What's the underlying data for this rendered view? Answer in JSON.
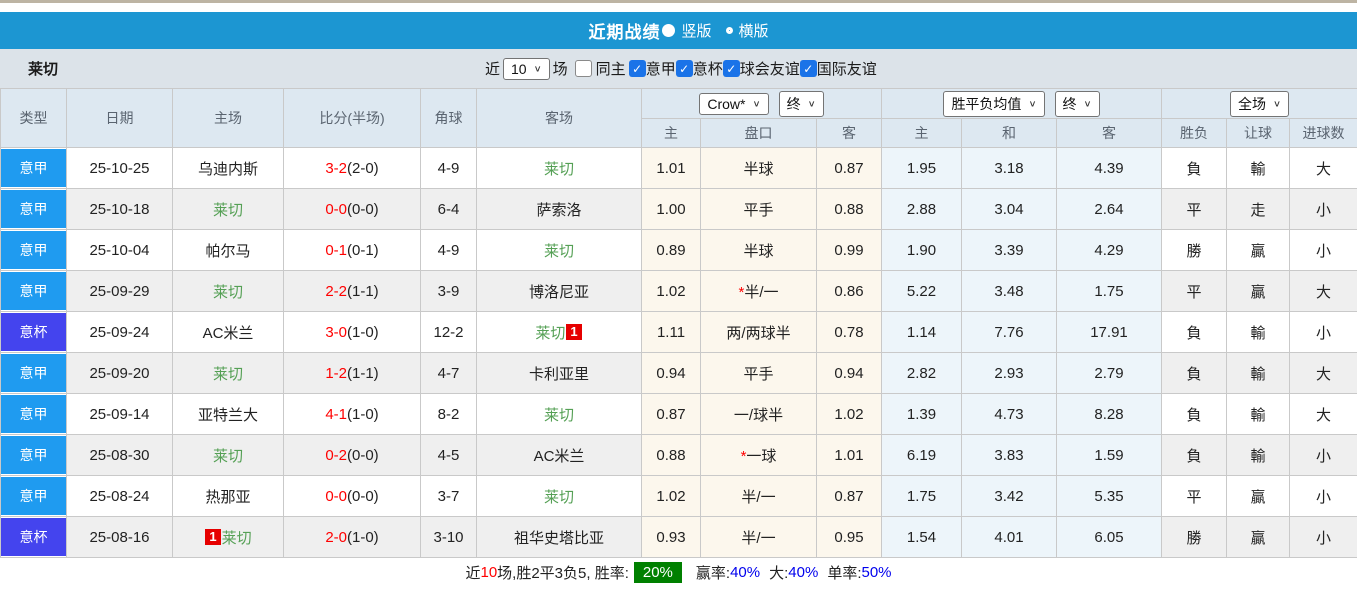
{
  "title_bar": {
    "title": "近期战绩",
    "radio_vertical": "竖版",
    "radio_horizontal": "横版"
  },
  "filter_bar": {
    "team": "莱切",
    "near_label": "近",
    "matches_select": "10",
    "matches_label": "场",
    "same_home_label": "同主",
    "same_home_checked": false,
    "checkboxes": [
      {
        "label": "意甲",
        "checked": true
      },
      {
        "label": "意杯",
        "checked": true
      },
      {
        "label": "球会友谊",
        "checked": true
      },
      {
        "label": "国际友谊",
        "checked": true
      }
    ]
  },
  "table": {
    "static_headers": [
      "类型",
      "日期",
      "主场",
      "比分(半场)",
      "角球",
      "客场"
    ],
    "odds_group": {
      "select1": "Crow*",
      "select2": "终",
      "columns": [
        "主",
        "盘口",
        "客"
      ]
    },
    "avg_group": {
      "select1": "胜平负均值",
      "select2": "终",
      "columns": [
        "主",
        "和",
        "客"
      ]
    },
    "result_group": {
      "select": "全场",
      "columns": [
        "胜负",
        "让球",
        "进球数"
      ]
    },
    "rows": [
      {
        "league": "意甲",
        "league_type": "serie_a",
        "date": "25-10-25",
        "home": {
          "name": "乌迪内斯",
          "lecce": false,
          "badge": null
        },
        "score": {
          "full": "3-2",
          "half": "(2-0)"
        },
        "corners": "4-9",
        "away": {
          "name": "莱切",
          "lecce": true,
          "badge": null
        },
        "odds": {
          "home": "1.01",
          "star": false,
          "handicap": "半球",
          "away": "0.87"
        },
        "avg": {
          "home": "1.95",
          "draw": "3.18",
          "away": "4.39"
        },
        "results": {
          "wdl": "負",
          "wdl_color": "green",
          "handicap": "輸",
          "handicap_color": "green",
          "goals": "大",
          "goals_color": "big"
        }
      },
      {
        "league": "意甲",
        "league_type": "serie_a",
        "date": "25-10-18",
        "home": {
          "name": "莱切",
          "lecce": true,
          "badge": null
        },
        "score": {
          "full": "0-0",
          "half": "(0-0)"
        },
        "corners": "6-4",
        "away": {
          "name": "萨索洛",
          "lecce": false,
          "badge": null
        },
        "odds": {
          "home": "1.00",
          "star": false,
          "handicap": "平手",
          "away": "0.88"
        },
        "avg": {
          "home": "2.88",
          "draw": "3.04",
          "away": "2.64"
        },
        "results": {
          "wdl": "平",
          "wdl_color": "blue",
          "handicap": "走",
          "handicap_color": "blue",
          "goals": "小",
          "goals_color": "small"
        }
      },
      {
        "league": "意甲",
        "league_type": "serie_a",
        "date": "25-10-04",
        "home": {
          "name": "帕尔马",
          "lecce": false,
          "badge": null
        },
        "score": {
          "full": "0-1",
          "half": "(0-1)"
        },
        "corners": "4-9",
        "away": {
          "name": "莱切",
          "lecce": true,
          "badge": null
        },
        "odds": {
          "home": "0.89",
          "star": false,
          "handicap": "半球",
          "away": "0.99"
        },
        "avg": {
          "home": "1.90",
          "draw": "3.39",
          "away": "4.29"
        },
        "results": {
          "wdl": "勝",
          "wdl_color": "red",
          "handicap": "贏",
          "handicap_color": "red",
          "goals": "小",
          "goals_color": "small"
        }
      },
      {
        "league": "意甲",
        "league_type": "serie_a",
        "date": "25-09-29",
        "home": {
          "name": "莱切",
          "lecce": true,
          "badge": null
        },
        "score": {
          "full": "2-2",
          "half": "(1-1)"
        },
        "corners": "3-9",
        "away": {
          "name": "博洛尼亚",
          "lecce": false,
          "badge": null
        },
        "odds": {
          "home": "1.02",
          "star": true,
          "handicap": "半/一",
          "away": "0.86"
        },
        "avg": {
          "home": "5.22",
          "draw": "3.48",
          "away": "1.75"
        },
        "results": {
          "wdl": "平",
          "wdl_color": "blue",
          "handicap": "贏",
          "handicap_color": "red",
          "goals": "大",
          "goals_color": "big"
        }
      },
      {
        "league": "意杯",
        "league_type": "italy_cup",
        "date": "25-09-24",
        "home": {
          "name": "AC米兰",
          "lecce": false,
          "badge": null
        },
        "score": {
          "full": "3-0",
          "half": "(1-0)"
        },
        "corners": "12-2",
        "away": {
          "name": "莱切",
          "lecce": true,
          "badge": {
            "text": "1",
            "pos": "after"
          }
        },
        "odds": {
          "home": "1.11",
          "star": false,
          "handicap": "两/两球半",
          "away": "0.78"
        },
        "avg": {
          "home": "1.14",
          "draw": "7.76",
          "away": "17.91"
        },
        "results": {
          "wdl": "負",
          "wdl_color": "green",
          "handicap": "輸",
          "handicap_color": "green",
          "goals": "小",
          "goals_color": "small"
        }
      },
      {
        "league": "意甲",
        "league_type": "serie_a",
        "date": "25-09-20",
        "home": {
          "name": "莱切",
          "lecce": true,
          "badge": null
        },
        "score": {
          "full": "1-2",
          "half": "(1-1)"
        },
        "corners": "4-7",
        "away": {
          "name": "卡利亚里",
          "lecce": false,
          "badge": null
        },
        "odds": {
          "home": "0.94",
          "star": false,
          "handicap": "平手",
          "away": "0.94"
        },
        "avg": {
          "home": "2.82",
          "draw": "2.93",
          "away": "2.79"
        },
        "results": {
          "wdl": "負",
          "wdl_color": "green",
          "handicap": "輸",
          "handicap_color": "green",
          "goals": "大",
          "goals_color": "big"
        }
      },
      {
        "league": "意甲",
        "league_type": "serie_a",
        "date": "25-09-14",
        "home": {
          "name": "亚特兰大",
          "lecce": false,
          "badge": null
        },
        "score": {
          "full": "4-1",
          "half": "(1-0)"
        },
        "corners": "8-2",
        "away": {
          "name": "莱切",
          "lecce": true,
          "badge": null
        },
        "odds": {
          "home": "0.87",
          "star": false,
          "handicap": "一/球半",
          "away": "1.02"
        },
        "avg": {
          "home": "1.39",
          "draw": "4.73",
          "away": "8.28"
        },
        "results": {
          "wdl": "負",
          "wdl_color": "green",
          "handicap": "輸",
          "handicap_color": "green",
          "goals": "大",
          "goals_color": "big"
        }
      },
      {
        "league": "意甲",
        "league_type": "serie_a",
        "date": "25-08-30",
        "home": {
          "name": "莱切",
          "lecce": true,
          "badge": null
        },
        "score": {
          "full": "0-2",
          "half": "(0-0)"
        },
        "corners": "4-5",
        "away": {
          "name": "AC米兰",
          "lecce": false,
          "badge": null
        },
        "odds": {
          "home": "0.88",
          "star": true,
          "handicap": "一球",
          "away": "1.01"
        },
        "avg": {
          "home": "6.19",
          "draw": "3.83",
          "away": "1.59"
        },
        "results": {
          "wdl": "負",
          "wdl_color": "green",
          "handicap": "輸",
          "handicap_color": "green",
          "goals": "小",
          "goals_color": "small"
        }
      },
      {
        "league": "意甲",
        "league_type": "serie_a",
        "date": "25-08-24",
        "home": {
          "name": "热那亚",
          "lecce": false,
          "badge": null
        },
        "score": {
          "full": "0-0",
          "half": "(0-0)"
        },
        "corners": "3-7",
        "away": {
          "name": "莱切",
          "lecce": true,
          "badge": null
        },
        "odds": {
          "home": "1.02",
          "star": false,
          "handicap": "半/一",
          "away": "0.87"
        },
        "avg": {
          "home": "1.75",
          "draw": "3.42",
          "away": "5.35"
        },
        "results": {
          "wdl": "平",
          "wdl_color": "blue",
          "handicap": "贏",
          "handicap_color": "red",
          "goals": "小",
          "goals_color": "small"
        }
      },
      {
        "league": "意杯",
        "league_type": "italy_cup",
        "date": "25-08-16",
        "home": {
          "name": "莱切",
          "lecce": true,
          "badge": {
            "text": "1",
            "pos": "before"
          }
        },
        "score": {
          "full": "2-0",
          "half": "(1-0)"
        },
        "corners": "3-10",
        "away": {
          "name": "祖华史塔比亚",
          "lecce": false,
          "badge": null
        },
        "odds": {
          "home": "0.93",
          "star": false,
          "handicap": "半/一",
          "away": "0.95"
        },
        "avg": {
          "home": "1.54",
          "draw": "4.01",
          "away": "6.05"
        },
        "results": {
          "wdl": "勝",
          "wdl_color": "red",
          "handicap": "贏",
          "handicap_color": "red",
          "goals": "小",
          "goals_color": "small"
        }
      }
    ]
  },
  "footer": {
    "near_label": "近",
    "count": "10",
    "middle": "场,胜2平3负5, 胜率:",
    "win_rate": "20%",
    "win_label": "赢率:",
    "win_pct": "40%",
    "big_label": "大:",
    "big_pct": "40%",
    "single_label": "单率:",
    "single_pct": "50%"
  },
  "colors": {
    "title_bar_blue": "#1c96d2",
    "serie_a_blue": "#1f9bf0",
    "italy_cup_indigo": "#4444ee",
    "filter_bar_gray": "#dce3e9",
    "header_bg": "#dde8f1",
    "odds_cream_bg": "#fcf7ed",
    "avg_blue_bg": "#edf5fa",
    "alt_row_gray": "#efefef",
    "team_green": "#55a055",
    "score_red": "#ff0000",
    "win_red": "#e03c3c",
    "draw_blue": "#3c3ccc",
    "lose_green": "#2e8b57",
    "rate_green_bg": "#008000",
    "rate_blue": "#0000ee",
    "checkbox_blue": "#1a73e8"
  }
}
